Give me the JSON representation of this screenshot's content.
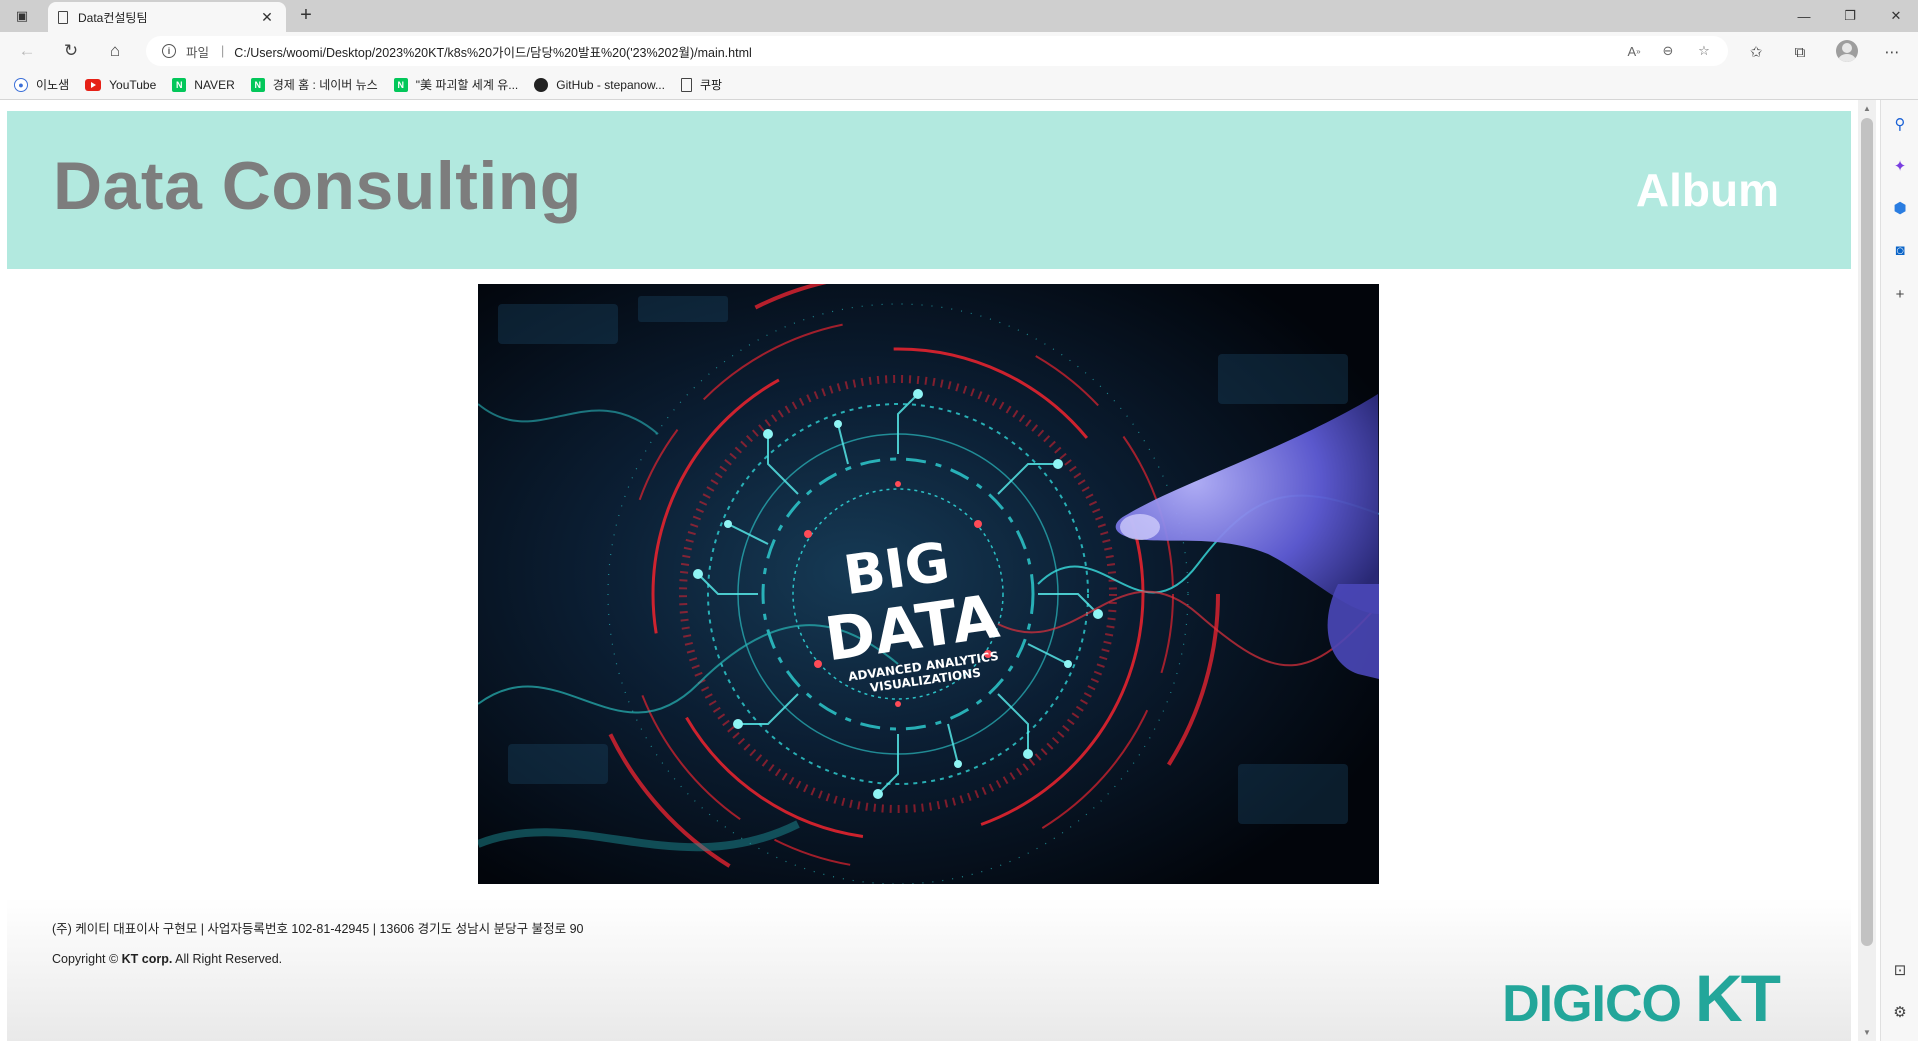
{
  "browser": {
    "tab_title": "Data컨설팅팀",
    "omnibox": {
      "scheme_label": "파일",
      "url": "C:/Users/woomi/Desktop/2023%20KT/k8s%20가이드/담당%20발표%20('23%202월)/main.html"
    },
    "bookmarks": [
      {
        "label": "이노샘",
        "icon": "user-icon"
      },
      {
        "label": "YouTube",
        "icon": "youtube-icon"
      },
      {
        "label": "NAVER",
        "icon": "naver-icon"
      },
      {
        "label": "경제 홈 : 네이버 뉴스",
        "icon": "naver-icon"
      },
      {
        "label": "\"美 파괴할 세계 유...",
        "icon": "naver-icon"
      },
      {
        "label": "GitHub - stepanow...",
        "icon": "github-icon"
      },
      {
        "label": "쿠팡",
        "icon": "document-icon"
      }
    ]
  },
  "page": {
    "header": {
      "title": "Data Consulting",
      "nav_album": "Album"
    },
    "hero": {
      "big": "BIG",
      "data": "DATA",
      "sub1": "ADVANCED ANALYTICS",
      "sub2": "VISUALIZATIONS"
    },
    "footer": {
      "company_info": "(주) 케이티 대표이사 구현모 | 사업자등록번호 102-81-42945 | 13606 경기도 성남시 분당구 불정로 90",
      "copyright_prefix": "Copyright © ",
      "copyright_company": "KT corp.",
      "copyright_suffix": " All Right Reserved.",
      "logo_digico": "DIGICO",
      "logo_kt": "KT"
    }
  },
  "colors": {
    "header_bg": "#b2e9df",
    "title_gray": "#7d7d7d",
    "brand_teal": "#23a69a"
  }
}
